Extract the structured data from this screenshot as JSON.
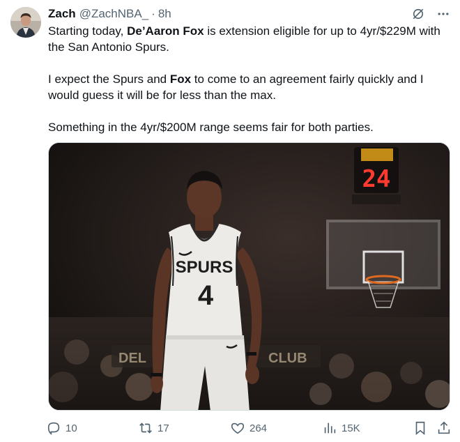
{
  "tweet": {
    "author_name": "Zach",
    "author_handle": "@ZachNBA_",
    "separator": "·",
    "time": "8h",
    "text": {
      "p1_a": "Starting today, ",
      "p1_b": "De’Aaron Fox",
      "p1_c": " is extension eligible for up to 4yr/$229M with the San Antonio Spurs.",
      "p2_a": "I expect the Spurs and ",
      "p2_b": "Fox",
      "p2_c": " to come to an agreement fairly quickly and I would guess it will be for less than the max.",
      "p3": "Something in the 4yr/$200M range seems fair for both parties."
    },
    "media": {
      "shot_clock": "24",
      "jersey_team": "SPURS",
      "jersey_number": "4",
      "banner_text_left": "DEL",
      "banner_text_right": "CLUB"
    },
    "actions": {
      "replies": "10",
      "reposts": "17",
      "likes": "264",
      "views": "15K"
    },
    "icons": [
      "reply-icon",
      "repost-icon",
      "like-icon",
      "views-icon",
      "bookmark-icon",
      "share-icon",
      "grok-icon",
      "more-icon"
    ]
  }
}
